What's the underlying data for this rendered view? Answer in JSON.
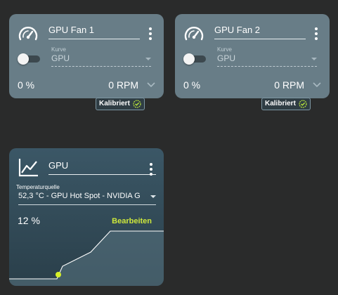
{
  "colors": {
    "background": "#2a2b2b",
    "fan_card": "#687d87",
    "curve_card": "#3b5766",
    "accent_green": "#cde73b",
    "badge_check": "#b8e43a"
  },
  "fans": [
    {
      "name": "GPU Fan 1",
      "curve_label": "Kurve",
      "curve_value": "GPU",
      "percent": "0 %",
      "rpm": "0 RPM",
      "badge": "Kalibriert",
      "toggle_on": false,
      "icon": "gauge-icon"
    },
    {
      "name": "GPU Fan 2",
      "curve_label": "Kurve",
      "curve_value": "GPU",
      "percent": "0 %",
      "rpm": "0 RPM",
      "badge": "Kalibriert",
      "toggle_on": false,
      "icon": "gauge-icon"
    }
  ],
  "curve": {
    "name": "GPU",
    "icon": "line-chart-icon",
    "temp_source_label": "Temperaturquelle",
    "temp_source_value": "52,3 °C - GPU Hot Spot - NVIDIA G",
    "percent": "12 %",
    "edit_label": "Bearbeiten"
  }
}
